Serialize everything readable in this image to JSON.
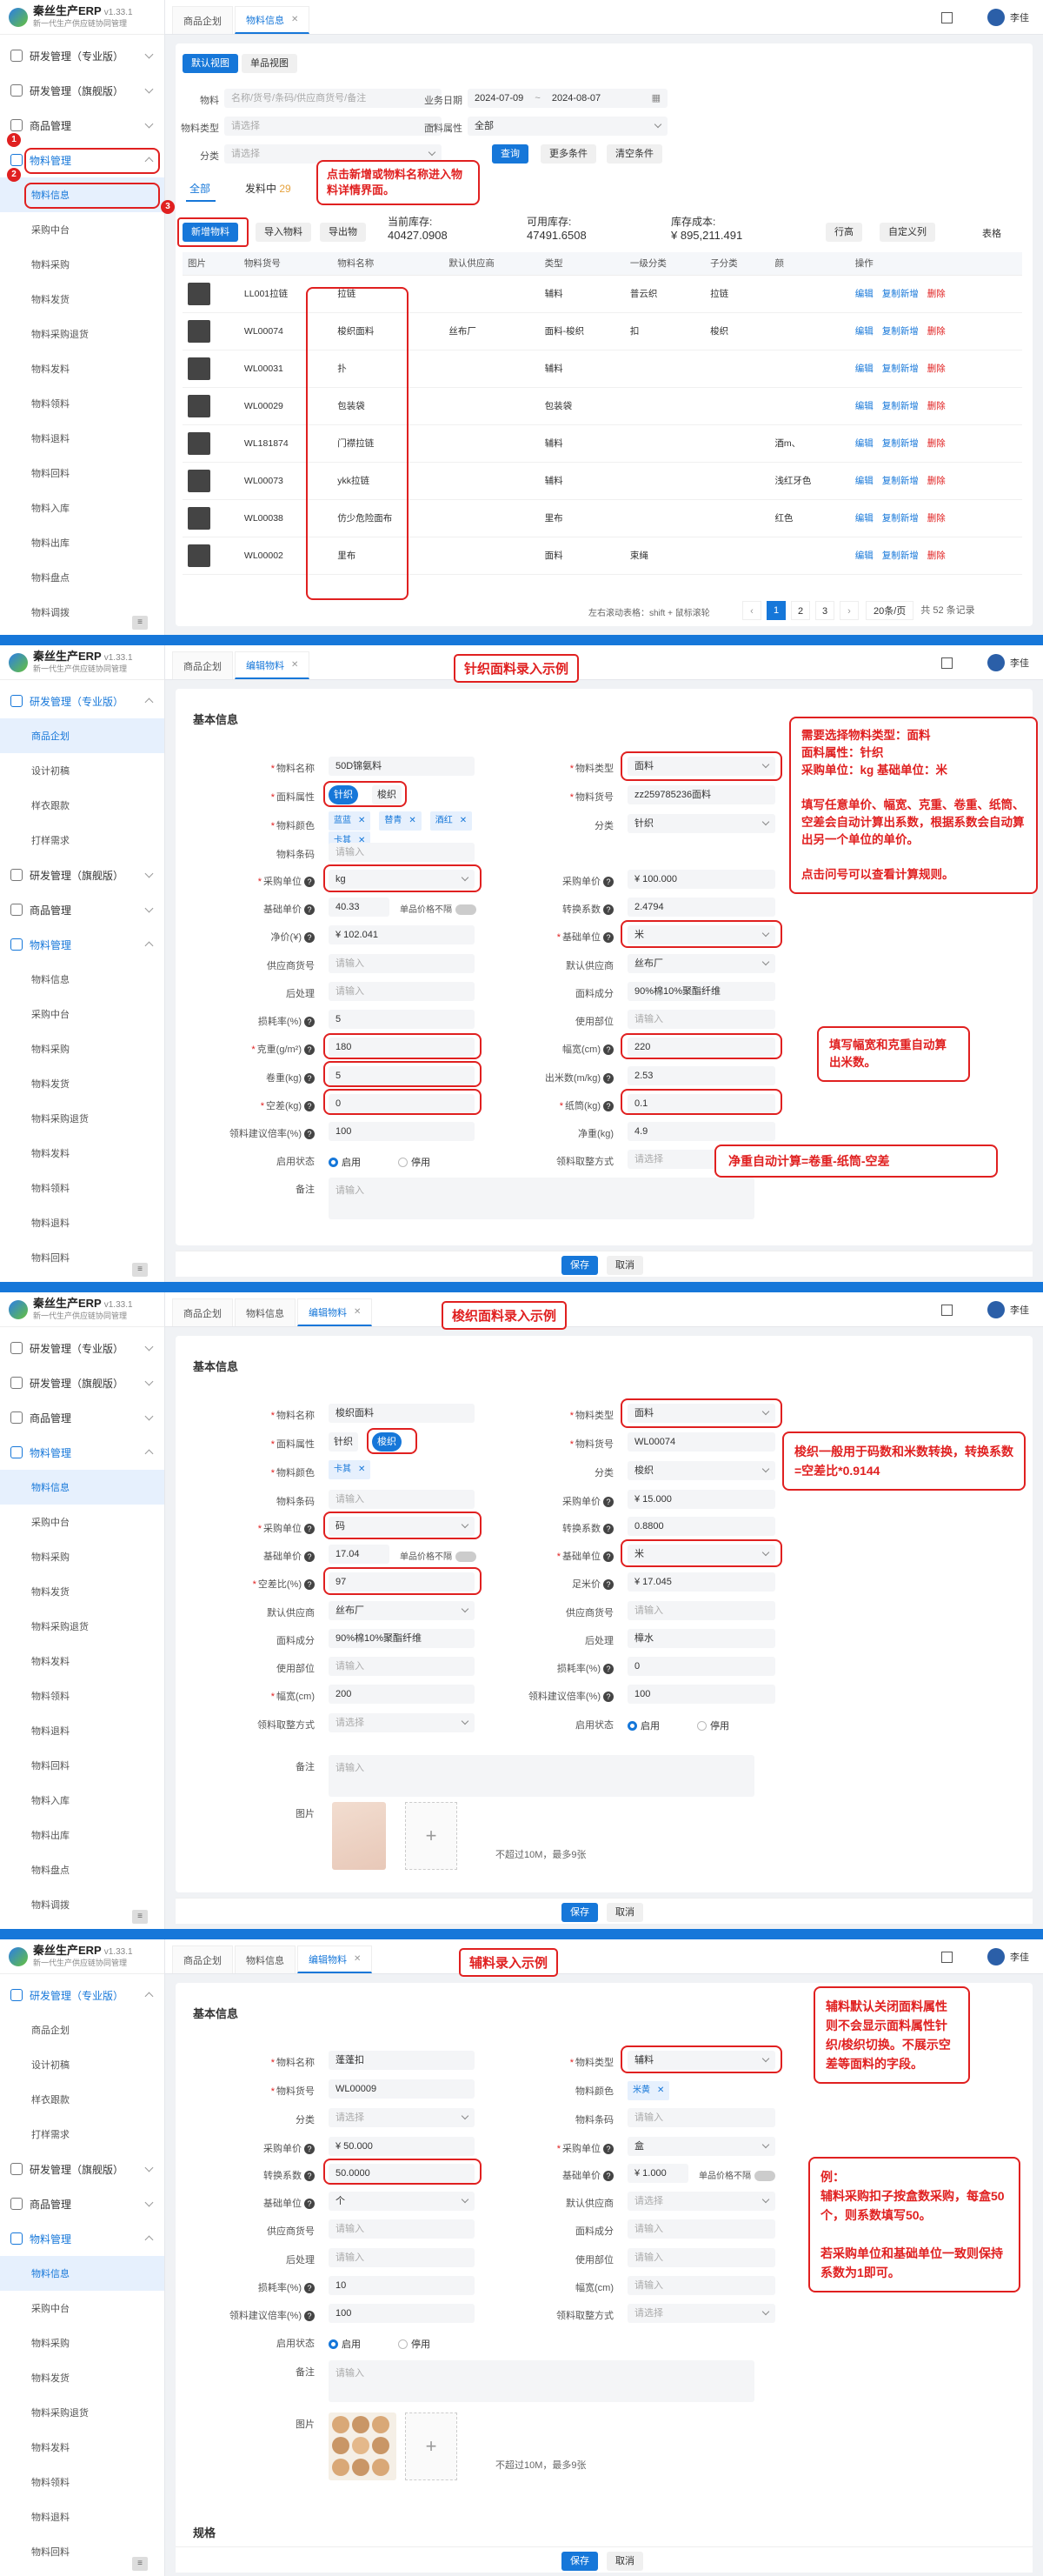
{
  "app": {
    "name": "秦丝生产ERP",
    "version": "v1.33.1",
    "tagline": "新一代生产供应链协同管理",
    "user": "李佳"
  },
  "s1": {
    "menu": [
      {
        "label": "研发管理（专业版）",
        "open": false
      },
      {
        "label": "研发管理（旗舰版）",
        "open": false
      },
      {
        "label": "商品管理",
        "open": false
      },
      {
        "label": "物料管理",
        "open": true
      }
    ],
    "sub": [
      "物料信息",
      "采购中台",
      "物料采购",
      "物料发货",
      "物料采购退货",
      "物料发料",
      "物料领料",
      "物料退料",
      "物料回料",
      "物料入库",
      "物料出库",
      "物料盘点",
      "物料调拨"
    ],
    "tabs": [
      "商品企划",
      "物料信息"
    ],
    "view_tabs": [
      "默认视图",
      "单品视图"
    ],
    "filters": {
      "material_label": "物料",
      "material_ph": "名称/货号/条码/供应商货号/备注",
      "date_label": "业务日期",
      "date_from": "2024-07-09",
      "date_sep": "~",
      "date_to": "2024-08-07",
      "type_label": "物料类型",
      "type_value": "请选择",
      "attr_label": "面料属性",
      "attr_value": "全部",
      "cat_label": "分类",
      "cat_value": "请选择",
      "query": "查询",
      "more": "更多条件",
      "clear": "清空条件"
    },
    "status_tabs": {
      "all": "全部",
      "sending": "发料中",
      "sending_count": "29"
    },
    "buttons": {
      "new": "新增物料",
      "import": "导入物料",
      "export": "导出物",
      "spread": "行高",
      "custom": "自定义列",
      "table": "表格"
    },
    "stats": {
      "stock_label": "当前库存:",
      "stock": "40427.0908",
      "avail_label": "可用库存:",
      "avail": "47491.6508",
      "cost_label": "库存成本:",
      "cost": "¥ 895,211.491"
    },
    "cols": [
      "图片",
      "物料货号",
      "物料名称",
      "默认供应商",
      "类型",
      "一级分类",
      "子分类",
      "颜",
      "操作"
    ],
    "rows": [
      {
        "code": "LL001拉链",
        "name": "拉链",
        "supplier": "",
        "type": "辅料",
        "c1": "普云织",
        "c2": "拉链",
        "color": ""
      },
      {
        "code": "WL00074",
        "name": "梭织面料",
        "supplier": "丝布厂",
        "type": "面料-梭织",
        "c1": "扣",
        "c2": "梭织",
        "color": ""
      },
      {
        "code": "WL00031",
        "name": "扑",
        "supplier": "",
        "type": "辅料",
        "c1": "",
        "c2": "",
        "color": ""
      },
      {
        "code": "WL00029",
        "name": "包装袋",
        "supplier": "",
        "type": "包装袋",
        "c1": "",
        "c2": "",
        "color": ""
      },
      {
        "code": "WL181874",
        "name": "门襟拉链",
        "supplier": "",
        "type": "辅料",
        "c1": "",
        "c2": "",
        "color": "酒m、"
      },
      {
        "code": "WL00073",
        "name": "ykk拉链",
        "supplier": "",
        "type": "辅料",
        "c1": "",
        "c2": "",
        "color": "浅红牙色"
      },
      {
        "code": "WL00038",
        "name": "仿少危险面布",
        "supplier": "",
        "type": "里布",
        "c1": "",
        "c2": "",
        "color": "红色"
      },
      {
        "code": "WL00002",
        "name": "里布",
        "supplier": "",
        "type": "面料",
        "c1": "束绳",
        "c2": "",
        "color": ""
      }
    ],
    "ops": {
      "edit": "编辑",
      "copy": "复制新增",
      "del": "删除"
    },
    "footer": {
      "hint": "左右滚动表格：shift + 鼠标滚轮",
      "pages": [
        "1",
        "2",
        "3"
      ],
      "per": "20条/页",
      "total": "共 52 条记录"
    },
    "callout": "点击新增或物料名称进入物料详情界面。",
    "badges": [
      "1",
      "2",
      "3"
    ]
  },
  "s2": {
    "title": "针织面料录入示例",
    "tabs": [
      "商品企划",
      "编辑物料"
    ],
    "menu": [
      {
        "label": "研发管理（专业版）"
      },
      {
        "label": "研发管理（旗舰版）"
      },
      {
        "label": "商品管理"
      },
      {
        "label": "物料管理"
      }
    ],
    "sub_a": [
      "商品企划",
      "设计初稿",
      "样衣跟款",
      "打样需求"
    ],
    "sub_b": [
      "物料信息",
      "采购中台",
      "物料采购",
      "物料发货",
      "物料采购退货",
      "物料发料",
      "物料领料",
      "物料退料",
      "物料回料"
    ],
    "section": "基本信息",
    "left": [
      {
        "label": "物料名称",
        "val": "50D锦氨料",
        "req": true
      },
      {
        "label": "面料属性",
        "val": "",
        "req": true
      },
      {
        "label": "物料颜色",
        "val": "",
        "req": true
      },
      {
        "label": "物料条码",
        "val": "请输入",
        "ph": true
      },
      {
        "label": "采购单位",
        "val": "kg",
        "req": true,
        "q": true
      },
      {
        "label": "基础单价",
        "val": "40.33",
        "q": true
      },
      {
        "label": "净价(¥)",
        "val": "¥  102.041",
        "q": true
      },
      {
        "label": "供应商货号",
        "val": "请输入",
        "ph": true
      },
      {
        "label": "后处理",
        "val": "请输入",
        "ph": true
      },
      {
        "label": "损耗率(%)",
        "val": "5",
        "q": true
      },
      {
        "label": "克重(g/m²)",
        "val": "180",
        "req": true,
        "q": true
      },
      {
        "label": "卷重(kg)",
        "val": "5",
        "q": true
      },
      {
        "label": "空差(kg)",
        "val": "0",
        "req": true,
        "q": true
      },
      {
        "label": "领料建议倍率(%)",
        "val": "100",
        "q": true
      },
      {
        "label": "启用状态",
        "val": ""
      },
      {
        "label": "备注",
        "val": ""
      }
    ],
    "right": [
      {
        "label": "物料类型",
        "val": "面料",
        "req": true
      },
      {
        "label": "物料货号",
        "val": "zz259785236面料",
        "req": true
      },
      {
        "label": "分类",
        "val": "针织"
      },
      {
        "label": "采购单价",
        "val": "¥  100.000",
        "q": true
      },
      {
        "label": "转换系数",
        "val": "2.4794",
        "q": true
      },
      {
        "label": "基础单位",
        "val": "米",
        "req": true,
        "q": true
      },
      {
        "label": "默认供应商",
        "val": "丝布厂"
      },
      {
        "label": "面料成分",
        "val": "90%棉10%聚酯纤维"
      },
      {
        "label": "使用部位",
        "val": "请输入",
        "ph": true
      },
      {
        "label": "幅宽(cm)",
        "val": "220",
        "q": true
      },
      {
        "label": "出米数(m/kg)",
        "val": "2.53",
        "q": true
      },
      {
        "label": "纸筒(kg)",
        "val": "0.1",
        "req": true,
        "q": true
      },
      {
        "label": "净重(kg)",
        "val": "4.9"
      },
      {
        "label": "领料取整方式",
        "val": "请选择",
        "ph": true
      }
    ],
    "attr_opts": [
      "针织",
      "梭织"
    ],
    "colors": [
      "蓝蓝",
      "替青",
      "酒红",
      "卡其"
    ],
    "unit_note": "单品价格不隔",
    "enable": "启用",
    "disable": "停用",
    "remark_ph": "请输入",
    "save": "保存",
    "cancel": "取消",
    "callout_a": "需要选择物料类型：面料\n面料属性：针织\n采购单位：kg    基础单位：米\n\n填写任意单价、幅宽、克重、卷重、纸筒、空差会自动计算出系数，根据系数会自动算出另一个单位的单价。\n\n点击问号可以查看计算规则。",
    "callout_b": "填写幅宽和克重自动算出米数。",
    "callout_c": "净重自动计算=卷重-纸筒-空差"
  },
  "s3": {
    "title": "梭织面料录入示例",
    "tabs": [
      "商品企划",
      "物料信息",
      "编辑物料"
    ],
    "section": "基本信息",
    "sub": [
      "物料信息",
      "采购中台",
      "物料采购",
      "物料发货",
      "物料采购退货",
      "物料发料",
      "物料领料",
      "物料退料",
      "物料回料",
      "物料入库",
      "物料出库",
      "物料盘点",
      "物料调拨"
    ],
    "left": [
      {
        "label": "物料名称",
        "val": "梭织面料",
        "req": true
      },
      {
        "label": "面料属性",
        "val": "",
        "req": true
      },
      {
        "label": "物料颜色",
        "val": "",
        "req": true
      },
      {
        "label": "物料条码",
        "val": "请输入",
        "ph": true
      },
      {
        "label": "采购单位",
        "val": "码",
        "req": true,
        "q": true
      },
      {
        "label": "基础单价",
        "val": "17.04",
        "q": true
      },
      {
        "label": "空差比(%)",
        "val": "97",
        "req": true,
        "q": true
      },
      {
        "label": "默认供应商",
        "val": "丝布厂"
      },
      {
        "label": "面料成分",
        "val": "90%棉10%聚酯纤维"
      },
      {
        "label": "使用部位",
        "val": "请输入",
        "ph": true
      },
      {
        "label": "幅宽(cm)",
        "val": "200",
        "req": true
      },
      {
        "label": "领料取整方式",
        "val": "请选择",
        "ph": true
      },
      {
        "label": "备注",
        "val": ""
      },
      {
        "label": "图片",
        "val": ""
      }
    ],
    "right": [
      {
        "label": "物料类型",
        "val": "面料",
        "req": true
      },
      {
        "label": "物料货号",
        "val": "WL00074",
        "req": true
      },
      {
        "label": "分类",
        "val": "梭织"
      },
      {
        "label": "采购单价",
        "val": "¥  15.000",
        "q": true
      },
      {
        "label": "转换系数",
        "val": "0.8800",
        "q": true
      },
      {
        "label": "基础单位",
        "val": "米",
        "req": true,
        "q": true
      },
      {
        "label": "足米价",
        "val": "¥  17.045",
        "q": true
      },
      {
        "label": "供应商货号",
        "val": "请输入",
        "ph": true
      },
      {
        "label": "后处理",
        "val": "樟水"
      },
      {
        "label": "损耗率(%)",
        "val": "0",
        "q": true
      },
      {
        "label": "领料建议倍率(%)",
        "val": "100",
        "q": true
      },
      {
        "label": "启用状态",
        "val": ""
      }
    ],
    "colors": [
      "卡其"
    ],
    "upload_note": "不超过10M，最多9张",
    "callout": "梭织一般用于码数和米数转换，转换系数=空差比*0.9144"
  },
  "s4": {
    "title": "辅料录入示例",
    "tabs": [
      "商品企划",
      "物料信息",
      "编辑物料"
    ],
    "section": "基本信息",
    "section2": "规格",
    "left": [
      {
        "label": "物料名称",
        "val": "蓬蓬扣",
        "req": true
      },
      {
        "label": "物料货号",
        "val": "WL00009",
        "req": true
      },
      {
        "label": "分类",
        "val": "请选择",
        "ph": true
      },
      {
        "label": "采购单价",
        "val": "¥  50.000",
        "q": true
      },
      {
        "label": "转换系数",
        "val": "50.0000",
        "q": true
      },
      {
        "label": "基础单位",
        "val": "个",
        "q": true
      },
      {
        "label": "供应商货号",
        "val": "请输入",
        "ph": true
      },
      {
        "label": "后处理",
        "val": "请输入",
        "ph": true
      },
      {
        "label": "损耗率(%)",
        "val": "10",
        "q": true
      },
      {
        "label": "领料建议倍率(%)",
        "val": "100",
        "q": true
      },
      {
        "label": "启用状态",
        "val": ""
      },
      {
        "label": "备注",
        "val": ""
      },
      {
        "label": "图片",
        "val": ""
      }
    ],
    "right": [
      {
        "label": "物料类型",
        "val": "辅料",
        "req": true
      },
      {
        "label": "物料颜色",
        "val": ""
      },
      {
        "label": "物料条码",
        "val": "请输入",
        "ph": true
      },
      {
        "label": "采购单位",
        "val": "盒",
        "req": true,
        "q": true
      },
      {
        "label": "基础单价",
        "val": "¥  1.000",
        "q": true
      },
      {
        "label": "默认供应商",
        "val": "请选择",
        "ph": true
      },
      {
        "label": "面料成分",
        "val": "请输入",
        "ph": true
      },
      {
        "label": "使用部位",
        "val": "请输入",
        "ph": true
      },
      {
        "label": "幅宽(cm)",
        "val": "请输入",
        "ph": true
      },
      {
        "label": "领料取整方式",
        "val": "请选择",
        "ph": true
      }
    ],
    "colors": [
      "米黄"
    ],
    "callout_a": "辅料默认关闭面料属性则不会显示面料属性针织/梭织切换。不展示空差等面料的字段。",
    "callout_b": "例：\n辅料采购扣子按盒数采购，每盒50个，则系数填写50。\n\n若采购单位和基础单位一致则保持系数为1即可。"
  }
}
